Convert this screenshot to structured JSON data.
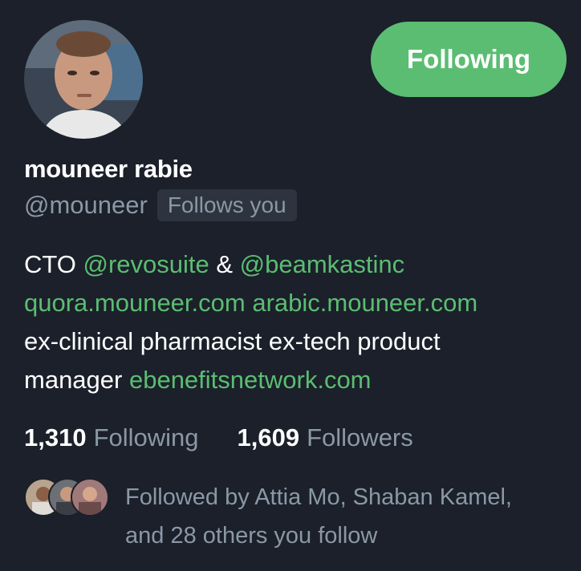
{
  "profile": {
    "name": "mouneer rabie",
    "handle": "@mouneer",
    "follows_you_badge": "Follows you",
    "follow_button_label": "Following"
  },
  "bio": {
    "line1_prefix": "CTO ",
    "mention1": "@revosuite",
    "line1_amp": " & ",
    "mention2": "@beamkastinc",
    "link1": "quora.mouneer.com",
    "link2": "arabic.mouneer.com",
    "line3": " ex-clinical pharmacist ex-tech product",
    "line4_prefix": "manager ",
    "link3": "ebenefitsnetwork.com"
  },
  "stats": {
    "following_count": "1,310",
    "following_label": "Following",
    "followers_count": "1,609",
    "followers_label": "Followers"
  },
  "mutuals": {
    "line1": "Followed by Attia Mo, Shaban Kamel,",
    "line2": "and 28 others you follow"
  },
  "colors": {
    "background": "#1b202a",
    "accent": "#5bbd72",
    "muted_text": "#8b98a5",
    "badge_bg": "#2d343f"
  }
}
